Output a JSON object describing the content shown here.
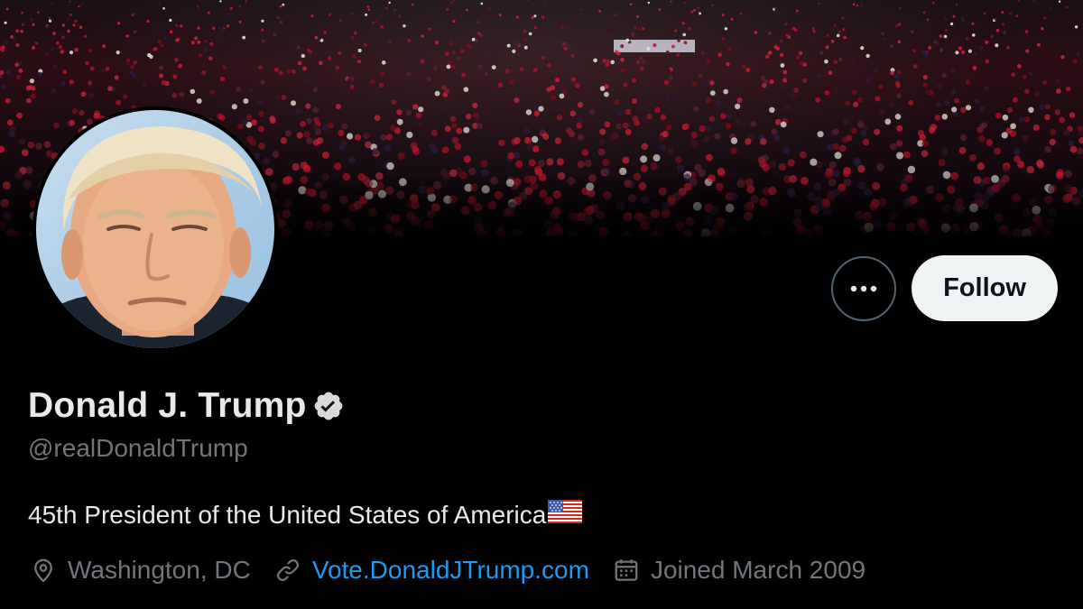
{
  "profile": {
    "display_name": "Donald J. Trump",
    "handle": "@realDonaldTrump",
    "verified": true,
    "bio": "45th President of the United States of America",
    "bio_flag": "us-flag-emoji",
    "location": "Washington, DC",
    "website": "Vote.DonaldJTrump.com",
    "joined": "Joined March 2009"
  },
  "actions": {
    "more_label": "More",
    "follow_label": "Follow"
  },
  "icons": {
    "verified": "verified-badge-icon",
    "more": "more-horizontal-icon",
    "location": "location-pin-icon",
    "link": "link-icon",
    "calendar": "calendar-icon"
  },
  "colors": {
    "background": "#000000",
    "primary_text": "#e7e9ea",
    "secondary_text": "#71767b",
    "link": "#1d9bf0",
    "follow_button_bg": "#eff3f4",
    "follow_button_text": "#0f1419"
  }
}
